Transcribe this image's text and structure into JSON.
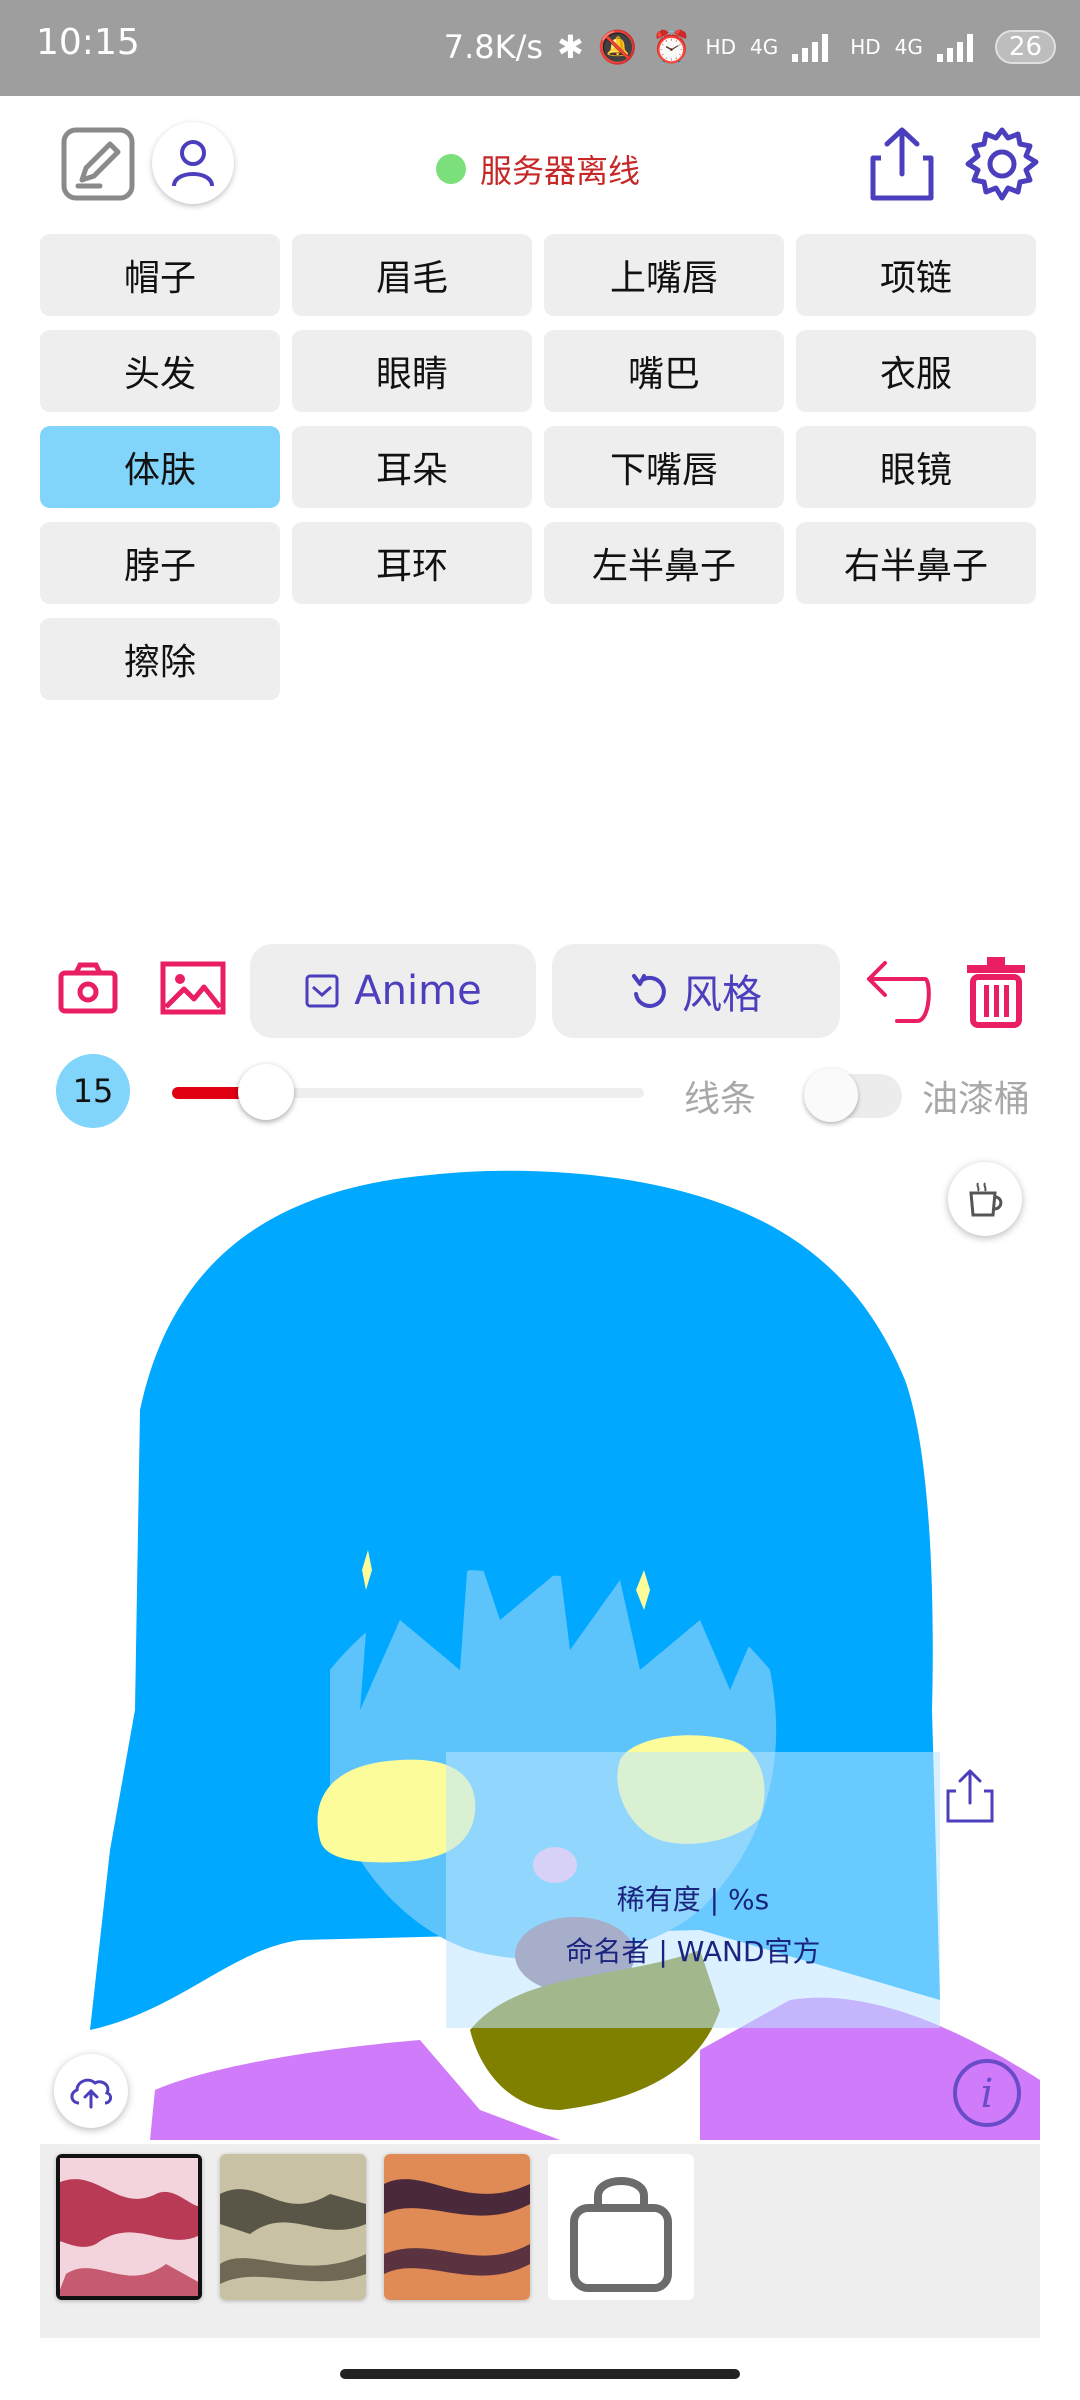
{
  "status_bar": {
    "time": "10:15",
    "network_speed": "7.8K/s",
    "hd_label": "HD",
    "net_type": "4G",
    "battery": "26"
  },
  "header": {
    "server_status": "服务器离线",
    "server_status_color": "#c62828",
    "online_dot_color": "#7be07b"
  },
  "parts": [
    {
      "label": "帽子",
      "selected": false
    },
    {
      "label": "眉毛",
      "selected": false
    },
    {
      "label": "上嘴唇",
      "selected": false
    },
    {
      "label": "项链",
      "selected": false
    },
    {
      "label": "头发",
      "selected": false
    },
    {
      "label": "眼睛",
      "selected": false
    },
    {
      "label": "嘴巴",
      "selected": false
    },
    {
      "label": "衣服",
      "selected": false
    },
    {
      "label": "体肤",
      "selected": true
    },
    {
      "label": "耳朵",
      "selected": false
    },
    {
      "label": "下嘴唇",
      "selected": false
    },
    {
      "label": "眼镜",
      "selected": false
    },
    {
      "label": "脖子",
      "selected": false
    },
    {
      "label": "耳环",
      "selected": false
    },
    {
      "label": "左半鼻子",
      "selected": false
    },
    {
      "label": "右半鼻子",
      "selected": false
    },
    {
      "label": "擦除",
      "selected": false
    }
  ],
  "toolbar": {
    "anime_label": "Anime",
    "style_label": "风格"
  },
  "brush": {
    "size": "15",
    "slider_fraction": 0.2,
    "line_label": "线条",
    "bucket_label": "油漆桶",
    "bucket_enabled": false
  },
  "overlay": {
    "rarity": "稀有度 | %s",
    "namer": "命名者 | WAND官方"
  },
  "colors": {
    "accent": "#e91e63",
    "primary": "#4b3fbd",
    "selected_part": "#81d4fa",
    "slider_fill": "#e00012",
    "hair": "#00a8ff",
    "skin": "#5cc4fb",
    "eyes": "#fdfc9b",
    "clothes": "#cf7bfa",
    "neck": "#808000"
  }
}
